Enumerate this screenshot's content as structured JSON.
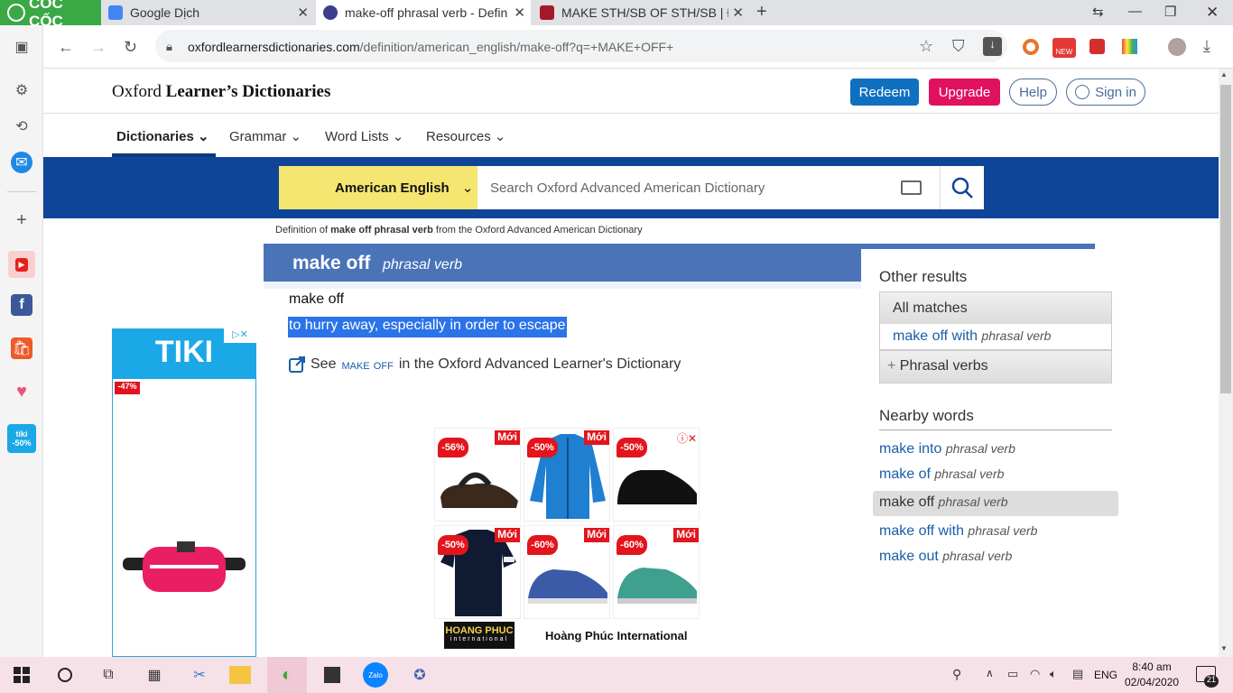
{
  "browser": {
    "logo_text": "CỐC CỐC",
    "tabs": [
      {
        "title": "Google Dịch"
      },
      {
        "title": "make-off phrasal verb - Defin"
      },
      {
        "title": "MAKE STH/SB OF STH/SB | Đị"
      }
    ],
    "url_host": "oxfordlearnersdictionaries.com",
    "url_path": "/definition/american_english/make-off?q=+MAKE+OFF+"
  },
  "sidebar": {
    "tiki_badge": "-50%"
  },
  "header": {
    "brand_1": "Oxford",
    "brand_2": "Learner’s Dictionaries",
    "redeem": "Redeem",
    "upgrade": "Upgrade",
    "help": "Help",
    "signin": "Sign in"
  },
  "nav": {
    "items": [
      "Dictionaries",
      "Grammar",
      "Word Lists",
      "Resources"
    ]
  },
  "search": {
    "dictionary": "American English",
    "placeholder": "Search Oxford Advanced American Dictionary"
  },
  "entry": {
    "note_prefix": "Definition of ",
    "note_bold": "make off phrasal verb",
    "note_suffix": " from the Oxford Advanced American Dictionary",
    "headword": "make off",
    "pos": "phrasal verb",
    "sense_head": "make off",
    "definition": "to hurry away, especially in order to escape",
    "see_prefix": "See",
    "see_link": "make off",
    "see_suffix": "in the Oxford Advanced Learner's Dictionary"
  },
  "other_results": {
    "title": "Other results",
    "all_matches": "All matches",
    "item_word": "make off with",
    "item_pos": "phrasal verb",
    "phrasal_verbs": "Phrasal verbs"
  },
  "nearby": {
    "title": "Nearby words",
    "items": [
      {
        "word": "make into",
        "pos": "phrasal verb"
      },
      {
        "word": "make of",
        "pos": "phrasal verb"
      },
      {
        "word": "make off",
        "pos": "phrasal verb"
      },
      {
        "word": "make off with",
        "pos": "phrasal verb"
      },
      {
        "word": "make out",
        "pos": "phrasal verb"
      }
    ]
  },
  "ads": {
    "tiki_logo": "TIKI",
    "tiki_discount": "-47%",
    "products": [
      {
        "discount": "-56%",
        "new": "Mới"
      },
      {
        "discount": "-50%",
        "new": "Mới"
      },
      {
        "discount": "-50%",
        "new": ""
      },
      {
        "discount": "-50%",
        "new": "Mới"
      },
      {
        "discount": "-60%",
        "new": "Mới"
      },
      {
        "discount": "-60%",
        "new": "Mới"
      }
    ],
    "brand_logo": "HOANG PHUC",
    "brand_logo_sub": "international",
    "brand_name": "Hoàng Phúc International"
  },
  "taskbar": {
    "time": "8:40 am",
    "date": "02/04/2020",
    "lang": "ENG",
    "notif": "21"
  }
}
